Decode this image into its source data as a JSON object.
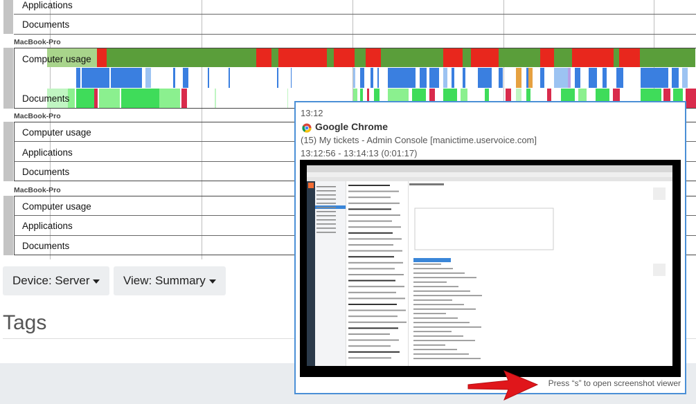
{
  "timeline": {
    "top_rows": [
      {
        "label": "Applications"
      },
      {
        "label": "Documents"
      }
    ],
    "devices": [
      {
        "name": "MacBook-Pro",
        "rows": [
          "Computer usage",
          "",
          "Documents"
        ]
      },
      {
        "name": "MacBook-Pro",
        "rows": [
          "Computer usage",
          "Applications",
          "Documents"
        ]
      },
      {
        "name": "MacBook-Pro",
        "rows": [
          "Computer usage",
          "Applications",
          "Documents"
        ]
      }
    ],
    "colors": {
      "active": "#5a9e3a",
      "away": "#e8271d",
      "apps": [
        "#3a7fe0",
        "#9cc3f2",
        "#e6a140",
        "#b7a0e6"
      ],
      "docs": [
        "#3fdc5a",
        "#8bf08f",
        "#c0f5c2",
        "#d92b4c"
      ]
    }
  },
  "controls": {
    "device_label": "Device: Server",
    "view_label": "View: Summary"
  },
  "tags": {
    "title": "Tags"
  },
  "popup": {
    "time": "13:12",
    "app_name": "Google Chrome",
    "app_icon": "chrome-icon",
    "window_title": "(15) My tickets - Admin Console [manictime.uservoice.com]",
    "duration": "13:12:56 - 13:14:13 (0:01:17)",
    "hint": "Press “s” to open screenshot viewer"
  }
}
